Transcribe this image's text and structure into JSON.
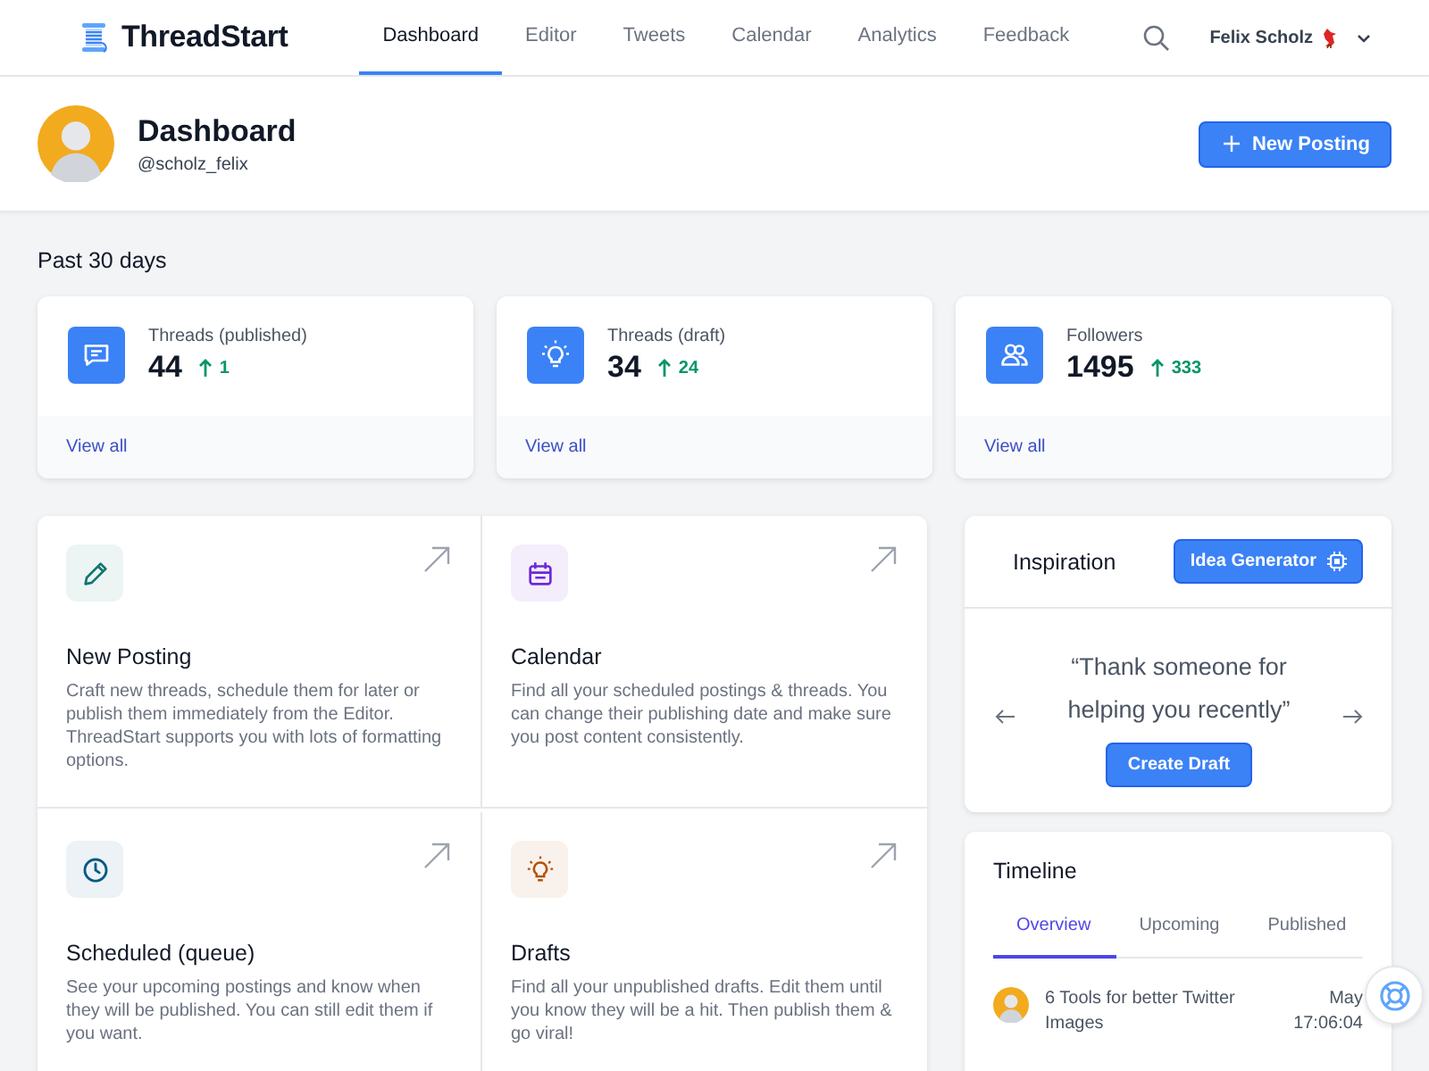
{
  "brand": {
    "name": "ThreadStart"
  },
  "nav": [
    {
      "label": "Dashboard",
      "selected": true
    },
    {
      "label": "Editor",
      "selected": false
    },
    {
      "label": "Tweets",
      "selected": false
    },
    {
      "label": "Calendar",
      "selected": false
    },
    {
      "label": "Analytics",
      "selected": false
    },
    {
      "label": "Feedback",
      "selected": false
    }
  ],
  "user": {
    "name": "Felix Scholz"
  },
  "profile": {
    "title": "Dashboard",
    "handle": "@scholz_felix",
    "button": "New Posting"
  },
  "period": "Past 30 days",
  "stats": [
    {
      "kind": "chat",
      "label": "Threads (published)",
      "value": "44",
      "change": "1",
      "link": "View all"
    },
    {
      "kind": "bulb",
      "label": "Threads (draft)",
      "value": "34",
      "change": "24",
      "link": "View all"
    },
    {
      "kind": "users",
      "label": "Followers",
      "value": "1495",
      "change": "333",
      "link": "View all"
    }
  ],
  "tiles": [
    {
      "kind": "pencil",
      "color": "#0f766e",
      "title": "New Posting",
      "description": "Craft new threads, schedule them for later or publish them immediately from the Editor. ThreadStart supports you with lots of formatting options."
    },
    {
      "kind": "calendar",
      "color": "#6d28d9",
      "title": "Calendar",
      "description": "Find all your scheduled postings & threads. You can change their publishing date and make sure you post content consistently."
    },
    {
      "kind": "clock",
      "color": "#075985",
      "title": "Scheduled (queue)",
      "description": "See your upcoming postings and know when they will be published. You can still edit them if you want."
    },
    {
      "kind": "bulb",
      "color": "#b45309",
      "title": "Drafts",
      "description": "Find all your unpublished drafts. Edit them until you know they will be a hit. Then publish them & go viral!"
    }
  ],
  "inspiration": {
    "title": "Inspiration",
    "button": "Idea Generator",
    "quote": "“Thank someone for helping you recently”",
    "action": "Create Draft"
  },
  "timeline": {
    "title": "Timeline",
    "tabs": [
      {
        "label": "Overview",
        "selected": true
      },
      {
        "label": "Upcoming",
        "selected": false
      },
      {
        "label": "Published",
        "selected": false
      }
    ],
    "items": [
      {
        "title": "6 Tools for better Twitter Images",
        "date": "May",
        "time": "17:06:04"
      }
    ]
  }
}
